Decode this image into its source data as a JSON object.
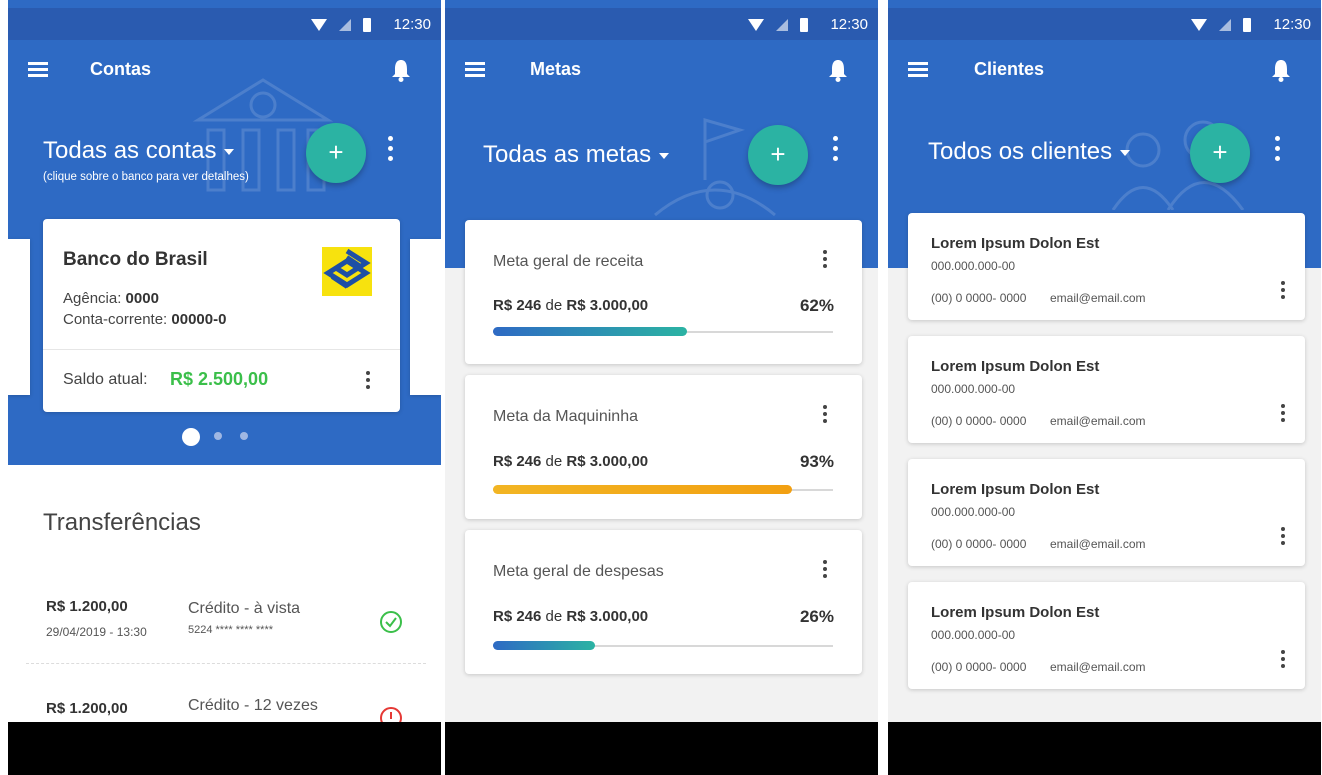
{
  "status_bar": {
    "time": "12:30"
  },
  "accounts_screen": {
    "app_title": "Contas",
    "header_title": "Todas as contas",
    "header_subtitle": "(clique sobre o banco para ver detalhes)",
    "fab_label": "+",
    "bank_card": {
      "name": "Banco do Brasil",
      "agency_label": "Agência:",
      "agency_value": "0000",
      "account_label": "Conta-corrente:",
      "account_value": "00000-0",
      "balance_label": "Saldo atual:",
      "balance_value": "R$ 2.500,00"
    },
    "carousel": {
      "pages": 3,
      "active": 1
    },
    "transfers_title": "Transferências",
    "transfers": [
      {
        "amount": "R$ 1.200,00",
        "datetime": "29/04/2019 - 13:30",
        "type": "Crédito - à vista",
        "card": "5224 **** **** ****",
        "status": "success"
      },
      {
        "amount": "R$ 1.200,00",
        "type": "Crédito - 12 vezes",
        "status": "error"
      }
    ]
  },
  "goals_screen": {
    "app_title": "Metas",
    "header_title": "Todas as metas",
    "fab_label": "+",
    "goals": [
      {
        "name": "Meta geral de receita",
        "current": "R$ 246",
        "of_word": "de",
        "target": "R$ 3.000,00",
        "percent_label": "62%",
        "bar_fraction": 0.57,
        "bar_color_start": "#2e6ac4",
        "bar_color_end": "#2bb3a3"
      },
      {
        "name": "Meta da Maquininha",
        "current": "R$ 246",
        "of_word": "de",
        "target": "R$ 3.000,00",
        "percent_label": "93%",
        "bar_fraction": 0.88,
        "bar_color_start": "#f2b523",
        "bar_color_end": "#f2a012"
      },
      {
        "name": "Meta geral de despesas",
        "current": "R$ 246",
        "of_word": "de",
        "target": "R$ 3.000,00",
        "percent_label": "26%",
        "bar_fraction": 0.3,
        "bar_color_start": "#2e6ac4",
        "bar_color_end": "#2bb3a3"
      }
    ]
  },
  "clients_screen": {
    "app_title": "Clientes",
    "header_title": "Todos os clientes",
    "fab_label": "+",
    "clients": [
      {
        "name": "Lorem Ipsum Dolon Est",
        "document": "000.000.000-00",
        "phone": "(00) 0 0000- 0000",
        "email": "email@email.com"
      },
      {
        "name": "Lorem Ipsum Dolon Est",
        "document": "000.000.000-00",
        "phone": "(00) 0 0000- 0000",
        "email": "email@email.com"
      },
      {
        "name": "Lorem Ipsum Dolon Est",
        "document": "000.000.000-00",
        "phone": "(00) 0 0000- 0000",
        "email": "email@email.com"
      },
      {
        "name": "Lorem Ipsum Dolon Est",
        "document": "000.000.000-00",
        "phone": "(00) 0 0000- 0000",
        "email": "email@email.com"
      }
    ]
  },
  "colors": {
    "primary_blue": "#2e6ac4",
    "status_bar_blue": "#2a5bb0",
    "fab_teal": "#2bb3a3",
    "balance_green": "#3bbf4a",
    "error_red": "#e53935"
  }
}
